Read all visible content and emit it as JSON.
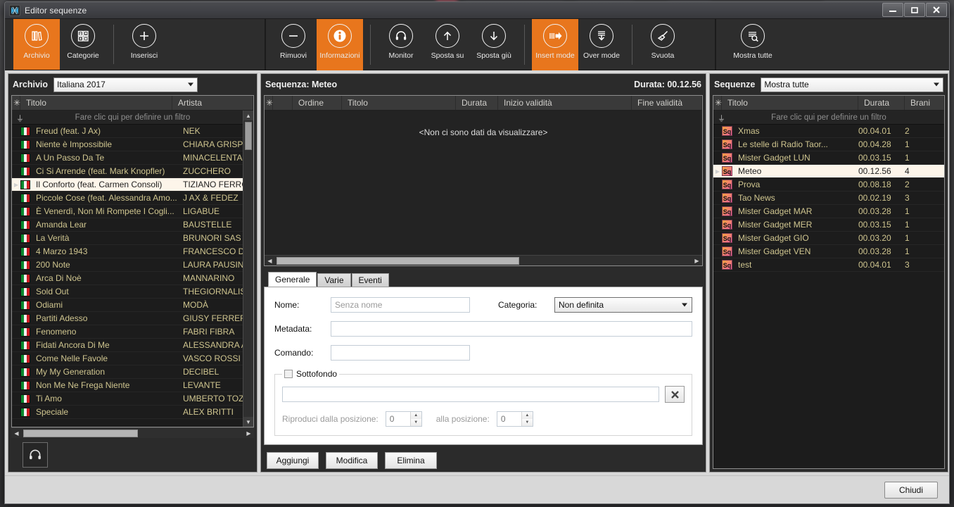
{
  "window": {
    "title": "Editor sequenze",
    "icon": "app-icon",
    "buttons": {
      "minimize": "—",
      "maximize": "❐",
      "close": "✕"
    }
  },
  "ribbon": {
    "groups": [
      {
        "name": "archive-group",
        "items": [
          {
            "label": "Archivio",
            "icon": "books-icon",
            "active": true
          },
          {
            "label": "Categorie",
            "icon": "grid-icon",
            "active": false
          }
        ]
      },
      {
        "name": "insert-group",
        "items": [
          {
            "label": "Inserisci",
            "icon": "plus-icon",
            "active": false
          }
        ]
      },
      {
        "name": "sequence-group",
        "items": [
          {
            "label": "Rimuovi",
            "icon": "minus-icon",
            "active": false
          },
          {
            "label": "Informazioni",
            "icon": "info-icon",
            "active": true
          }
        ]
      },
      {
        "name": "move-group",
        "items": [
          {
            "label": "Monitor",
            "icon": "headphones-icon",
            "active": false
          },
          {
            "label": "Sposta su",
            "icon": "arrow-up-icon",
            "active": false
          },
          {
            "label": "Sposta giù",
            "icon": "arrow-down-icon",
            "active": false
          }
        ]
      },
      {
        "name": "mode-group",
        "items": [
          {
            "label": "Insert mode",
            "icon": "insert-mode-icon",
            "active": true
          },
          {
            "label": "Over mode",
            "icon": "over-mode-icon",
            "active": false
          }
        ]
      },
      {
        "name": "clear-group",
        "items": [
          {
            "label": "Svuota",
            "icon": "broom-icon",
            "active": false
          }
        ]
      }
    ],
    "right_group": [
      {
        "label": "Mostra tutte",
        "icon": "show-all-icon",
        "active": false
      }
    ]
  },
  "archive": {
    "title": "Archivio",
    "selected_list": "Italiana 2017",
    "columns": [
      "",
      "Titolo",
      "Artista"
    ],
    "filter_hint": "Fare clic qui per definire un filtro",
    "monitor_button_icon": "headphones-icon",
    "rows": [
      {
        "title": "Freud (feat. J Ax)",
        "artist": "NEK",
        "selected": false
      },
      {
        "title": "Niente è Impossibile",
        "artist": "CHIARA GRISPO",
        "selected": false
      },
      {
        "title": "A Un Passo Da Te",
        "artist": "MINACELENTANO",
        "selected": false
      },
      {
        "title": "Ci Si Arrende (feat. Mark Knopfler)",
        "artist": "ZUCCHERO",
        "selected": false
      },
      {
        "title": "Il Conforto (feat. Carmen Consoli)",
        "artist": "TIZIANO FERRO",
        "selected": true
      },
      {
        "title": "Piccole Cose (feat. Alessandra Amo...",
        "artist": "J AX & FEDEZ",
        "selected": false
      },
      {
        "title": "È Venerdì, Non Mi Rompete I Cogli...",
        "artist": "LIGABUE",
        "selected": false
      },
      {
        "title": "Amanda Lear",
        "artist": "BAUSTELLE",
        "selected": false
      },
      {
        "title": "La Verità",
        "artist": "BRUNORI SAS",
        "selected": false
      },
      {
        "title": "4 Marzo 1943",
        "artist": "FRANCESCO DE",
        "selected": false
      },
      {
        "title": "200 Note",
        "artist": "LAURA PAUSINI",
        "selected": false
      },
      {
        "title": "Arca Di Noè",
        "artist": "MANNARINO",
        "selected": false
      },
      {
        "title": "Sold Out",
        "artist": "THEGIORNALIST",
        "selected": false
      },
      {
        "title": "Odiami",
        "artist": "MODÀ",
        "selected": false
      },
      {
        "title": "Partiti Adesso",
        "artist": "GIUSY FERRERI",
        "selected": false
      },
      {
        "title": "Fenomeno",
        "artist": "FABRI FIBRA",
        "selected": false
      },
      {
        "title": "Fidati Ancora Di Me",
        "artist": "ALESSANDRA AM",
        "selected": false
      },
      {
        "title": "Come Nelle Favole",
        "artist": "VASCO ROSSI",
        "selected": false
      },
      {
        "title": "My My Generation",
        "artist": "DECIBEL",
        "selected": false
      },
      {
        "title": "Non Me Ne Frega Niente",
        "artist": "LEVANTE",
        "selected": false
      },
      {
        "title": "Ti Amo",
        "artist": "UMBERTO TOZZI",
        "selected": false
      },
      {
        "title": "Speciale",
        "artist": "ALEX BRITTI",
        "selected": false
      }
    ]
  },
  "sequence": {
    "label": "Sequenza: Meteo",
    "duration": "Durata: 00.12.56",
    "columns": [
      "",
      "Ordine",
      "Titolo",
      "Durata",
      "Inizio validità",
      "Fine validità"
    ],
    "empty_message": "<Non ci sono dati da visualizzare>"
  },
  "form": {
    "tabs": [
      {
        "label": "Generale",
        "active": true
      },
      {
        "label": "Varie",
        "active": false
      },
      {
        "label": "Eventi",
        "active": false
      }
    ],
    "nome_label": "Nome:",
    "nome_placeholder": "Senza nome",
    "nome_value": "",
    "categoria_label": "Categoria:",
    "categoria_value": "Non definita",
    "metadata_label": "Metadata:",
    "metadata_value": "",
    "comando_label": "Comando:",
    "comando_value": "",
    "sottofondo_label": "Sottofondo",
    "sottofondo_checked": false,
    "sottofondo_path": "",
    "clear_button_icon": "x-icon",
    "from_label": "Riproduci dalla posizione:",
    "from_value": "0",
    "to_label": "alla posizione:",
    "to_value": "0",
    "buttons": {
      "add": "Aggiungi",
      "edit": "Modifica",
      "delete": "Elimina"
    }
  },
  "sequences": {
    "title": "Sequenze",
    "filter_value": "Mostra tutte",
    "columns": [
      "",
      "Titolo",
      "Durata",
      "Brani"
    ],
    "filter_hint": "Fare clic qui per definire un filtro",
    "rows": [
      {
        "title": "Xmas",
        "duration": "00.04.01",
        "tracks": "2",
        "selected": false
      },
      {
        "title": "Le stelle di Radio Taor...",
        "duration": "00.04.28",
        "tracks": "1",
        "selected": false
      },
      {
        "title": "Mister Gadget LUN",
        "duration": "00.03.15",
        "tracks": "1",
        "selected": false
      },
      {
        "title": "Meteo",
        "duration": "00.12.56",
        "tracks": "4",
        "selected": true
      },
      {
        "title": "Prova",
        "duration": "00.08.18",
        "tracks": "2",
        "selected": false
      },
      {
        "title": "Tao News",
        "duration": "00.02.19",
        "tracks": "3",
        "selected": false
      },
      {
        "title": "Mister Gadget MAR",
        "duration": "00.03.28",
        "tracks": "1",
        "selected": false
      },
      {
        "title": "Mister Gadget MER",
        "duration": "00.03.15",
        "tracks": "1",
        "selected": false
      },
      {
        "title": "Mister Gadget GIO",
        "duration": "00.03.20",
        "tracks": "1",
        "selected": false
      },
      {
        "title": "Mister Gadget VEN",
        "duration": "00.03.28",
        "tracks": "1",
        "selected": false
      },
      {
        "title": "test",
        "duration": "00.04.01",
        "tracks": "3",
        "selected": false
      }
    ]
  },
  "footer": {
    "close_label": "Chiudi"
  },
  "colors": {
    "accent": "#e8761d",
    "window_bg": "#2b2b2b",
    "row_text": "#cfc58f",
    "panel_bg": "#d8d8d8"
  }
}
